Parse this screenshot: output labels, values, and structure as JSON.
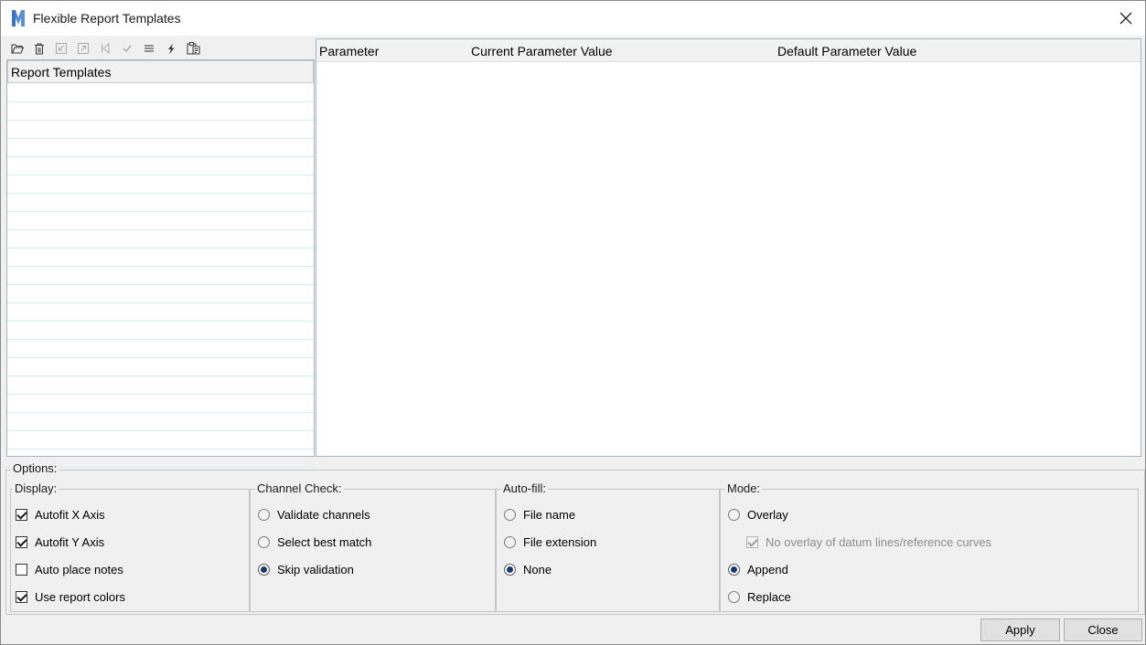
{
  "window": {
    "title": "Flexible Report Templates",
    "accent_color": "#2e6db4"
  },
  "toolbar": {
    "icons": [
      "open-folder-icon",
      "delete-icon",
      "import-icon",
      "export-icon",
      "first-icon",
      "check-icon",
      "list-icon",
      "lightning-icon",
      "clipboard-icon"
    ]
  },
  "left_panel": {
    "header": "Report Templates",
    "rows": [
      "",
      "",
      "",
      "",
      "",
      "",
      "",
      "",
      "",
      "",
      "",
      "",
      "",
      "",
      "",
      "",
      "",
      "",
      "",
      "",
      ""
    ]
  },
  "right_panel": {
    "columns": [
      "Parameter",
      "Current Parameter Value",
      "Default Parameter Value"
    ]
  },
  "options": {
    "label": "Options:",
    "display": {
      "label": "Display:",
      "items": [
        {
          "label": "Autofit X Axis",
          "checked": true
        },
        {
          "label": "Autofit Y Axis",
          "checked": true
        },
        {
          "label": "Auto place notes",
          "checked": false
        },
        {
          "label": "Use report colors",
          "checked": true
        }
      ]
    },
    "channel_check": {
      "label": "Channel Check:",
      "items": [
        {
          "label": "Validate channels",
          "selected": false
        },
        {
          "label": "Select best match",
          "selected": false
        },
        {
          "label": "Skip validation",
          "selected": true
        }
      ]
    },
    "auto_fill": {
      "label": "Auto-fill:",
      "items": [
        {
          "label": "File name",
          "selected": false
        },
        {
          "label": "File extension",
          "selected": false
        },
        {
          "label": "None",
          "selected": true
        }
      ]
    },
    "mode": {
      "label": "Mode:",
      "overlay": "Overlay",
      "no_overlay": "No overlay of datum lines/reference curves",
      "append": "Append",
      "replace": "Replace"
    }
  },
  "buttons": {
    "apply": "Apply",
    "close": "Close"
  }
}
